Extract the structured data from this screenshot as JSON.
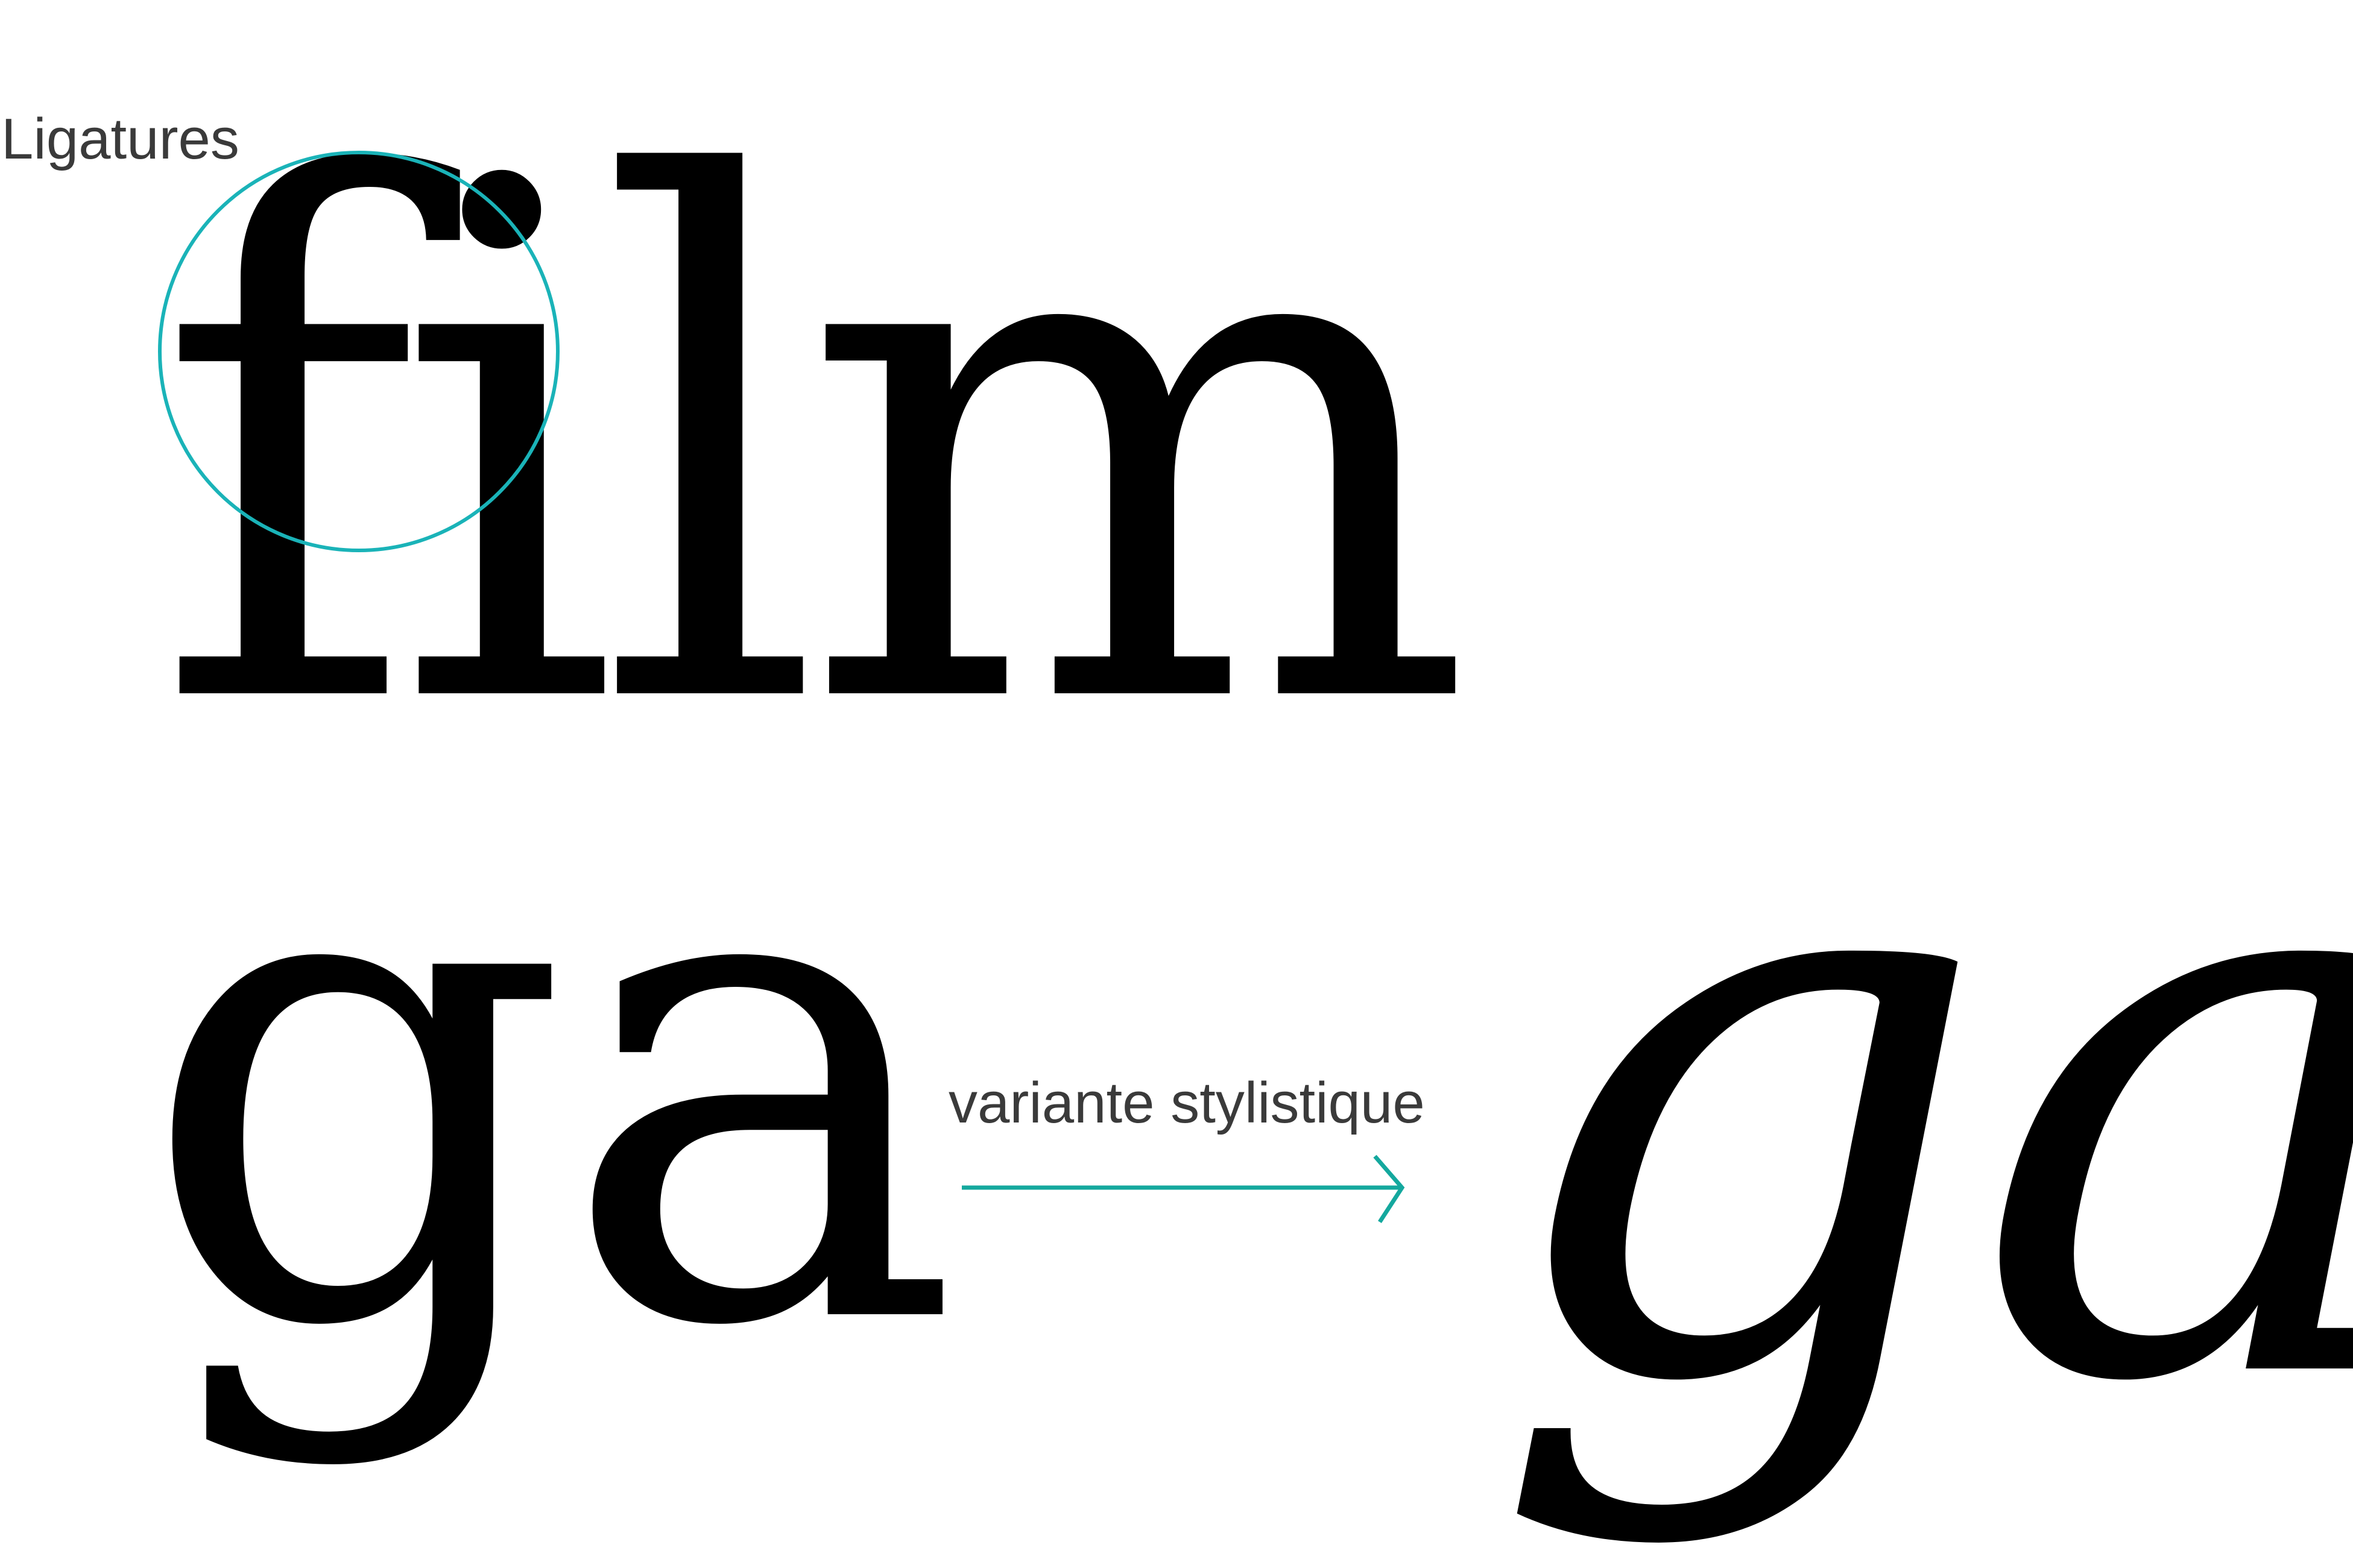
{
  "top_row": {
    "label": "Ligatures",
    "word": "film"
  },
  "bottom_row": {
    "label": "variante stylistique",
    "default_text": "ga",
    "alternate_text": "ga"
  },
  "colors": {
    "accent": "#1ab3b8",
    "arrow": "#14a89e",
    "glyph": "#000000",
    "label": "#3a3a3a"
  },
  "icons": {
    "ligature_marker": "circle-highlight-icon",
    "transform_arrow": "arrow-right-icon"
  }
}
